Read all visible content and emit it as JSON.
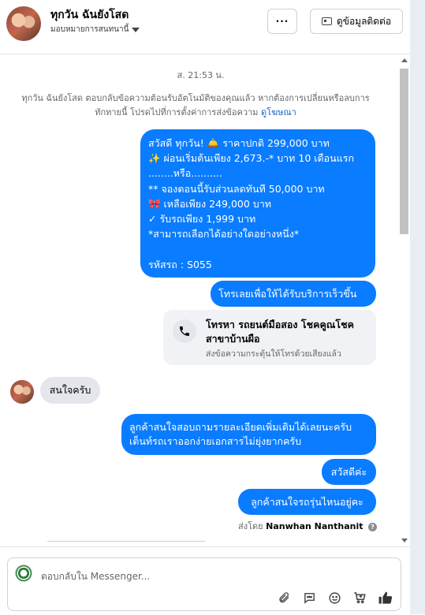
{
  "header": {
    "contact_name": "ทุกวัน ฉันยังโสด",
    "assign_label": "มอบหมายการสนทนานี้",
    "more_label": "···",
    "contact_info_label": "ดูข้อมูลติดต่อ"
  },
  "conversation": {
    "timestamp": "ส. 21:53 น.",
    "notice_text": "ทุกวัน ฉันยังโสด ตอบกลับข้อความต้อนรับอัตโนมัติของคุณแล้ว หากต้องการเปลี่ยนหรือลบการทักทายนี้ โปรดไปที่การตั้งค่าการส่งข้อความ",
    "notice_link": "ดูโฆษณา",
    "promo_lines": [
      "สวัสดี ทุกวัน! 🛎️ ราคาปกติ 299,000 บาท",
      "✨  ผ่อนเริ่มต้นเพียง 2,673.-* บาท 10 เดือนแรก",
      "........หรือ..........",
      "** จองตอนนี้รับส่วนลดทันที 50,000 บาท",
      "🎀  เหลือเพียง 249,000 บาท",
      "✓ รับรถเพียง 1,999 บาท",
      "*สามารถเลือกได้อย่างใดอย่างหนึ่ง*",
      "",
      " รหัสรถ : S055"
    ],
    "call_button_text": "โทรเลยเพื่อให้ได้รับบริการเร็วขึ้น",
    "call_card_title": "โทรหา รถยนต์มือสอง โชคคูณโชค สาขาบ้านผือ",
    "call_card_subtitle": "ส่งข้อความกระตุ้นให้โทรด้วยเสียงแล้ว",
    "incoming_message": "สนใจครับ",
    "reply_1": "ลูกค้าสนใจสอบถามรายละเอียดเพิ่มเติมได้เลยนะครับ เต็นท์รถเราออกง่ายเอกสารไม่ยุ่งยากครับ",
    "reply_2": "สวัสดีค่ะ",
    "reply_3": "ลูกค้าสนใจรถรุ่นไหนอยู่คะ",
    "sent_by_prefix": "ส่งโดย",
    "sent_by_name": "Nanwhan Nanthanit"
  },
  "composer": {
    "placeholder": "ตอบกลับใน Messenger..."
  },
  "icons": [
    "caret-down-icon",
    "id-card-icon",
    "phone-icon",
    "help-icon",
    "attach-icon",
    "saved-reply-icon",
    "emoji-icon",
    "cart-icon",
    "like-icon"
  ],
  "colors": {
    "outgoing_bubble": "#0a7cff",
    "incoming_bubble": "#e4e6eb",
    "link": "#1666c5"
  }
}
